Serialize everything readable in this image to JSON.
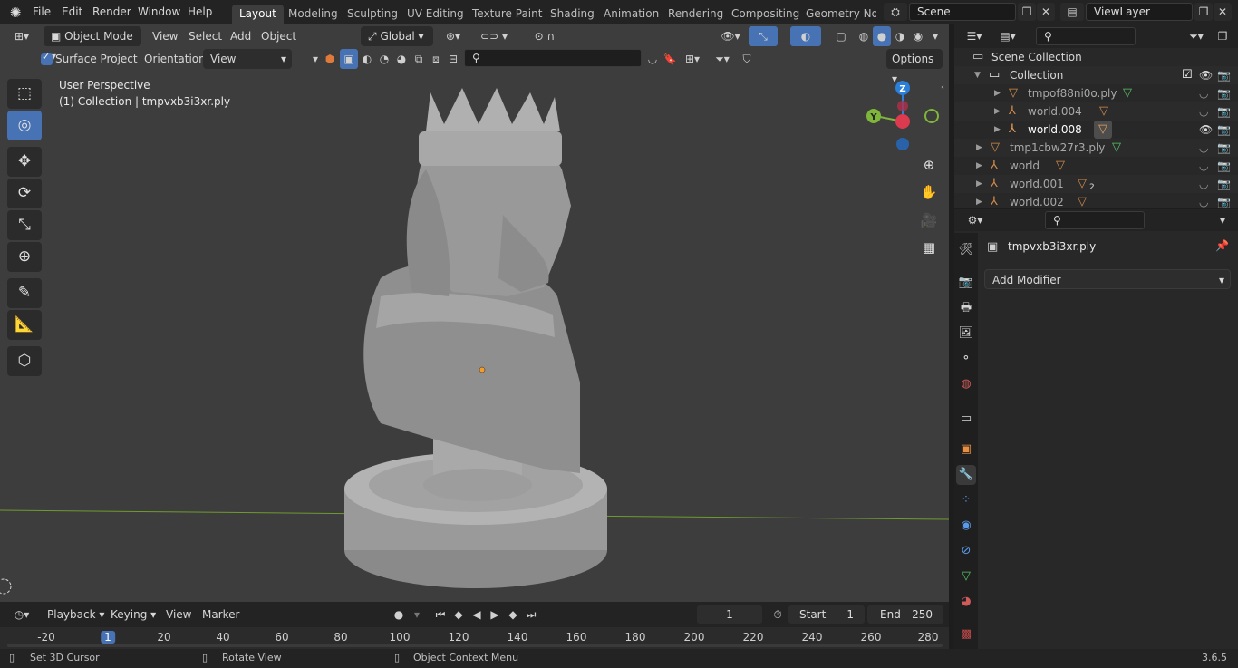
{
  "menubar": {
    "items": [
      "File",
      "Edit",
      "Render",
      "Window",
      "Help"
    ],
    "workspaces": [
      "Layout",
      "Modeling",
      "Sculpting",
      "UV Editing",
      "Texture Paint",
      "Shading",
      "Animation",
      "Rendering",
      "Compositing",
      "Geometry Noc"
    ],
    "scene_label": "Scene",
    "viewlayer_label": "ViewLayer"
  },
  "viewport": {
    "mode": "Object Mode",
    "menus": [
      "View",
      "Select",
      "Add",
      "Object"
    ],
    "transform_orientation": "Global",
    "surface_project_label": "Surface Project",
    "orientation_label": "Orientation:",
    "orientation_value": "View",
    "options_label": "Options",
    "perspective_label": "User Perspective",
    "active_object_label": "(1) Collection | tmpvxb3i3xr.ply",
    "gizmo_axes": {
      "z": "Z",
      "y": "Y"
    },
    "colors": {
      "x_axis": "#dc3a4e",
      "y_axis": "#7fb53b",
      "z_axis": "#2a7fd9",
      "floor_line": "#6e9b2e",
      "active_tool": "#4772b3"
    }
  },
  "timeline": {
    "menus": [
      "Playback",
      "Keying",
      "View",
      "Marker"
    ],
    "current_frame": "1",
    "start_label": "Start",
    "start_value": "1",
    "end_label": "End",
    "end_value": "250",
    "ruler_ticks": [
      "-20",
      "1",
      "20",
      "40",
      "60",
      "80",
      "100",
      "120",
      "140",
      "160",
      "180",
      "200",
      "220",
      "240",
      "260",
      "280"
    ]
  },
  "statusbar": {
    "items": [
      "Set 3D Cursor",
      "Rotate View",
      "Object Context Menu"
    ],
    "version": "3.6.5"
  },
  "outliner": {
    "root": "Scene Collection",
    "rows": [
      {
        "label": "Collection",
        "depth": 1,
        "icon": "collection-icon"
      },
      {
        "label": "tmpof88ni0o.ply",
        "depth": 2,
        "icon": "mesh-object-icon"
      },
      {
        "label": "world.004",
        "depth": 2,
        "icon": "empty-object-icon"
      },
      {
        "label": "world.008",
        "depth": 2,
        "icon": "empty-object-icon"
      },
      {
        "label": "tmp1cbw27r3.ply",
        "depth": 1,
        "icon": "mesh-object-icon"
      },
      {
        "label": "world",
        "depth": 1,
        "icon": "empty-object-icon"
      },
      {
        "label": "world.001",
        "depth": 1,
        "icon": "empty-object-icon",
        "badge": "2"
      },
      {
        "label": "world.002",
        "depth": 1,
        "icon": "empty-object-icon"
      }
    ]
  },
  "properties": {
    "object_name": "tmpvxb3i3xr.ply",
    "add_modifier_label": "Add Modifier"
  }
}
